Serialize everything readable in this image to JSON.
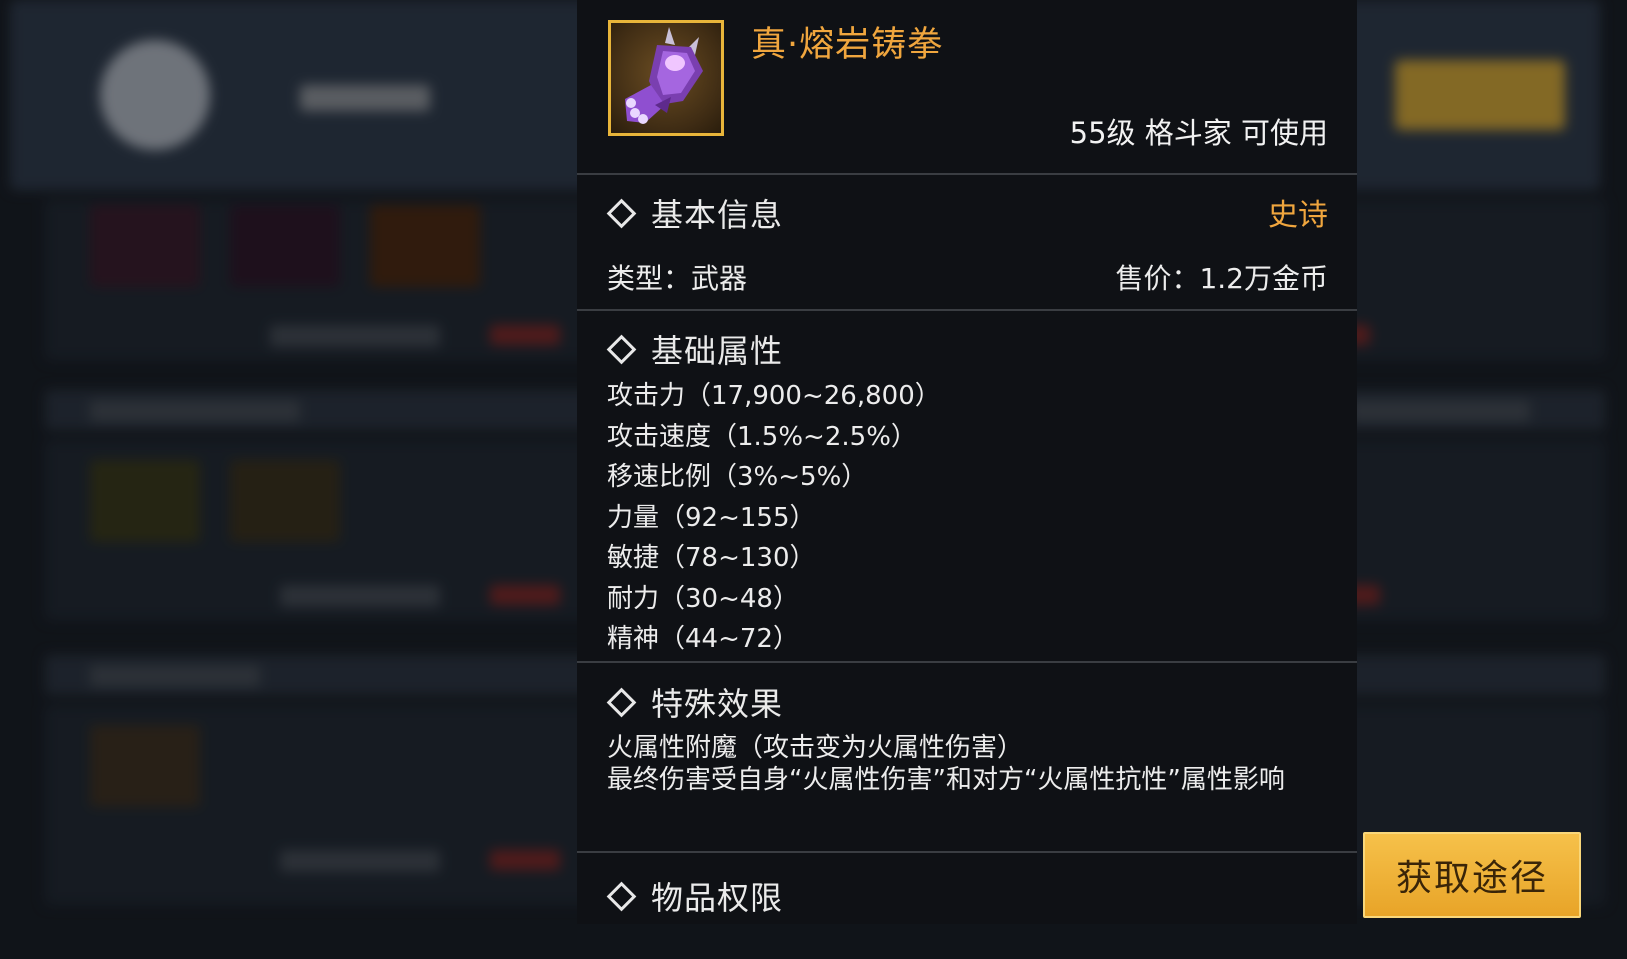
{
  "item": {
    "name": "真·熔岩铸拳",
    "requirement": "55级 格斗家 可使用",
    "icon": "lava-gauntlet-icon"
  },
  "basic_info": {
    "title": "基本信息",
    "rarity": "史诗",
    "type": "类型：武器",
    "price": "售价：1.2万金币"
  },
  "base_attributes": {
    "title": "基础属性",
    "items": [
      "攻击力（17,900~26,800）",
      "攻击速度（1.5%~2.5%）",
      "移速比例（3%~5%）",
      "力量（92~155）",
      "敏捷（78~130）",
      "耐力（30~48）",
      "精神（44~72）"
    ]
  },
  "special_effects": {
    "title": "特殊效果",
    "lines": [
      "火属性附魔（攻击变为火属性伤害）",
      "最终伤害受自身“火属性伤害”和对方“火属性抗性”属性影响"
    ]
  },
  "permissions": {
    "title": "物品权限"
  },
  "acquire_button": {
    "label": "获取途径"
  },
  "colors": {
    "epic": "#f0a63e",
    "button": "#f6c14a",
    "panel": "#0f1115"
  }
}
